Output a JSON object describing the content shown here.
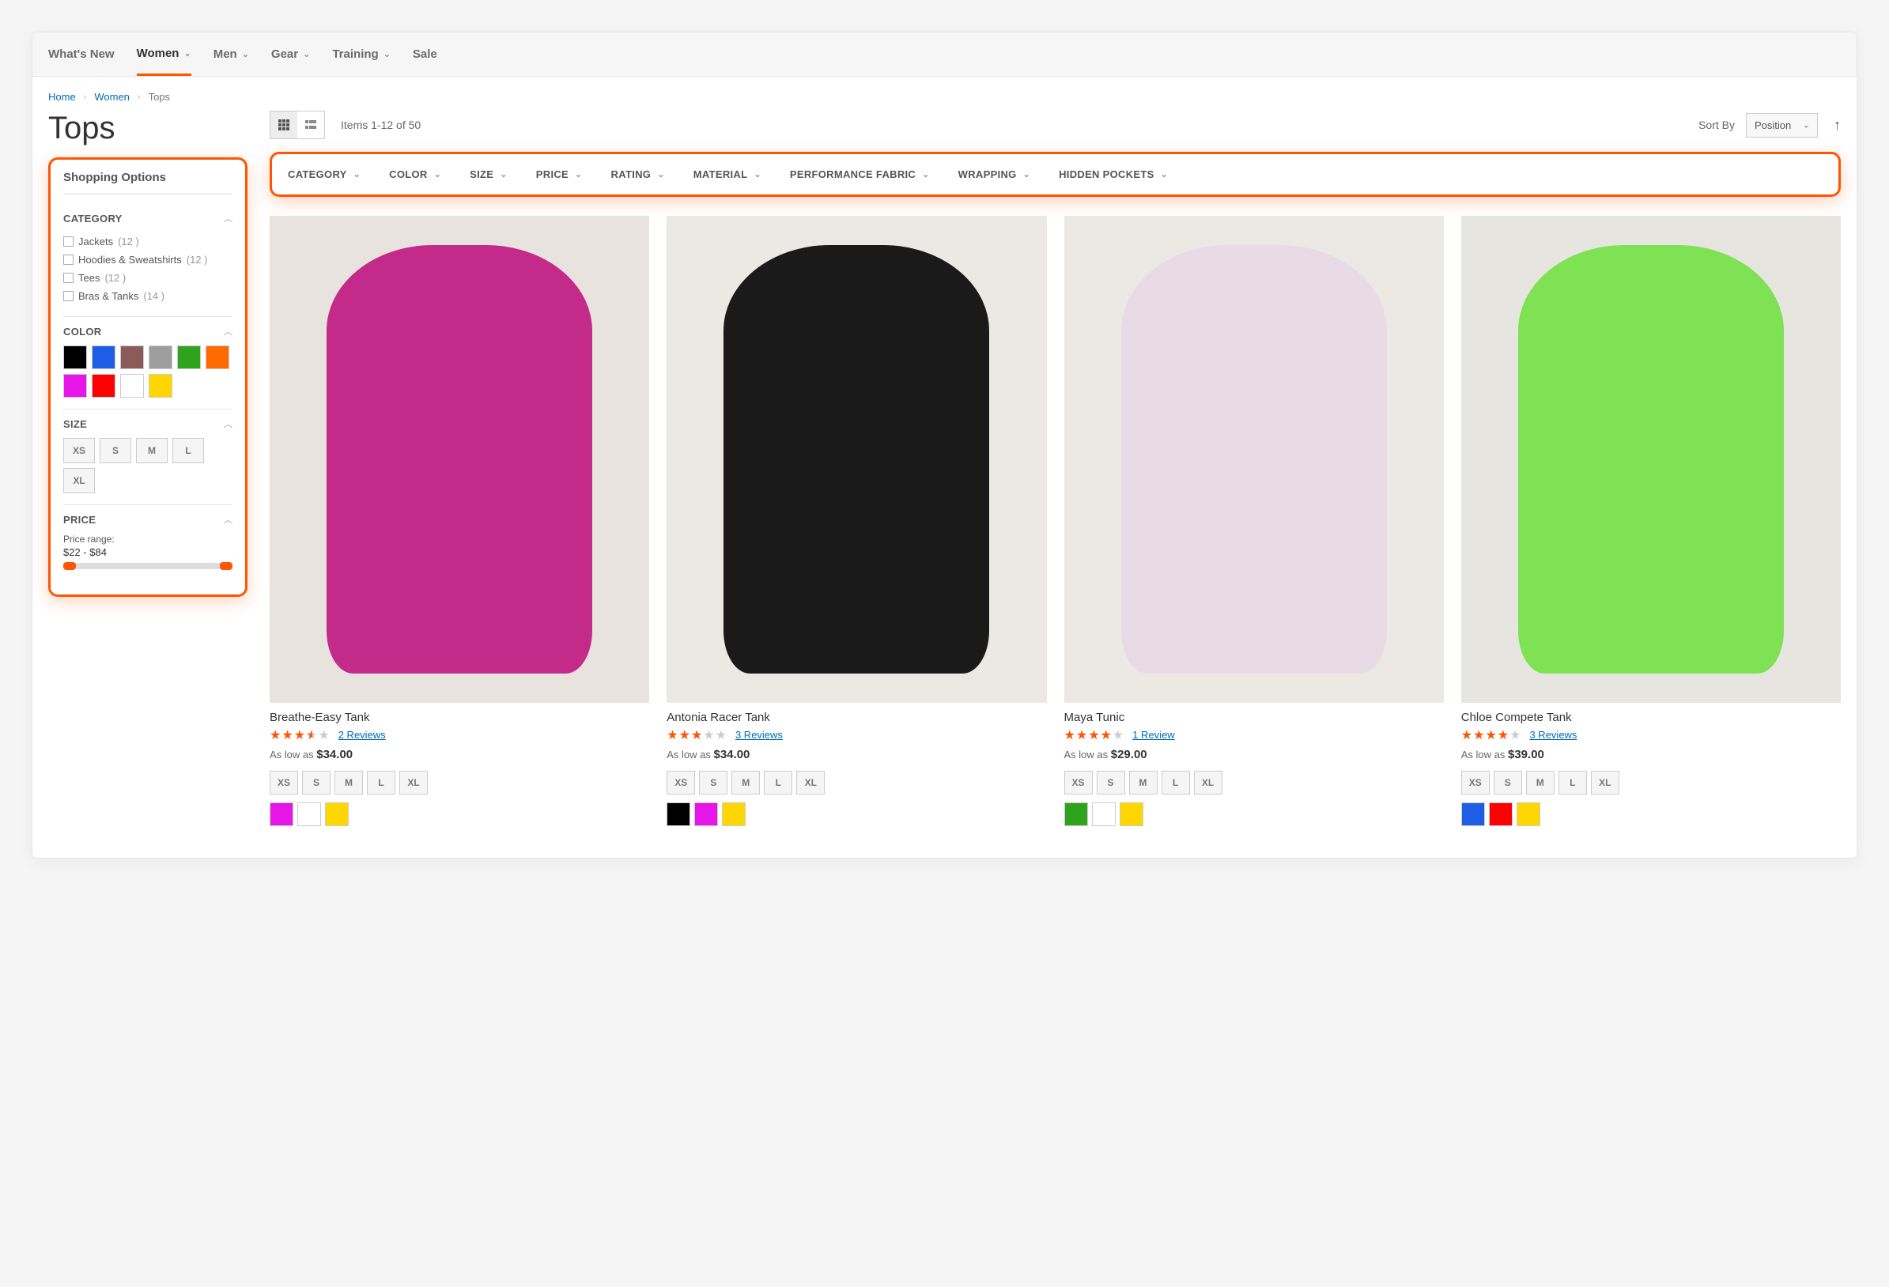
{
  "topnav": [
    {
      "label": "What's New",
      "dropdown": false
    },
    {
      "label": "Women",
      "dropdown": true,
      "active": true
    },
    {
      "label": "Men",
      "dropdown": true
    },
    {
      "label": "Gear",
      "dropdown": true
    },
    {
      "label": "Training",
      "dropdown": true
    },
    {
      "label": "Sale",
      "dropdown": false
    }
  ],
  "breadcrumb": [
    {
      "label": "Home",
      "link": true
    },
    {
      "label": "Women",
      "link": true
    },
    {
      "label": "Tops",
      "link": false
    }
  ],
  "page_title": "Tops",
  "toolbar": {
    "count_text": "Items 1-12 of 50",
    "sort_label": "Sort By",
    "sort_value": "Position"
  },
  "sidebar": {
    "title": "Shopping Options",
    "groups": {
      "category": {
        "label": "CATEGORY",
        "items": [
          {
            "label": "Jackets",
            "count": "12"
          },
          {
            "label": "Hoodies & Sweatshirts",
            "count": "12"
          },
          {
            "label": "Tees",
            "count": "12"
          },
          {
            "label": "Bras & Tanks",
            "count": "14"
          }
        ]
      },
      "color": {
        "label": "COLOR",
        "swatches": [
          "#000000",
          "#1e5ee6",
          "#8b5a5a",
          "#9e9e9e",
          "#2fa31b",
          "#ff6a00",
          "#e815e8",
          "#ff0000",
          "#ffffff",
          "#ffd600"
        ]
      },
      "size": {
        "label": "SIZE",
        "options": [
          "XS",
          "S",
          "M",
          "L",
          "XL"
        ]
      },
      "price": {
        "label": "PRICE",
        "range_label": "Price range:",
        "range_value": "$22 - $84"
      }
    }
  },
  "hfilters": [
    "CATEGORY",
    "COLOR",
    "SIZE",
    "PRICE",
    "RATING",
    "MATERIAL",
    "PERFORMANCE FABRIC",
    "WRAPPING",
    "HIDDEN POCKETS"
  ],
  "size_options": [
    "XS",
    "S",
    "M",
    "L",
    "XL"
  ],
  "products": [
    {
      "name": "Breathe-Easy Tank",
      "rating_pct": 70,
      "reviews": "2 Reviews",
      "price_prefix": "As low as",
      "price": "$34.00",
      "colors": [
        "#e815e8",
        "#ffffff",
        "#ffd600"
      ],
      "img_bg": "#e9e3df",
      "sil": "#c32a8a"
    },
    {
      "name": "Antonia Racer Tank",
      "rating_pct": 60,
      "reviews": "3 Reviews",
      "price_prefix": "As low as",
      "price": "$34.00",
      "colors": [
        "#000000",
        "#e815e8",
        "#ffd600"
      ],
      "img_bg": "#ece8e4",
      "sil": "#1a1a1a"
    },
    {
      "name": "Maya Tunic",
      "rating_pct": 80,
      "reviews": "1 Review",
      "price_prefix": "As low as",
      "price": "$29.00",
      "colors": [
        "#2fa31b",
        "#ffffff",
        "#ffd600"
      ],
      "img_bg": "#ece9e5",
      "sil": "#e9dbe6"
    },
    {
      "name": "Chloe Compete Tank",
      "rating_pct": 80,
      "reviews": "3 Reviews",
      "price_prefix": "As low as",
      "price": "$39.00",
      "colors": [
        "#1e5ee6",
        "#ff0000",
        "#ffd600"
      ],
      "img_bg": "#e7e5e0",
      "sil": "#7ee254"
    }
  ]
}
